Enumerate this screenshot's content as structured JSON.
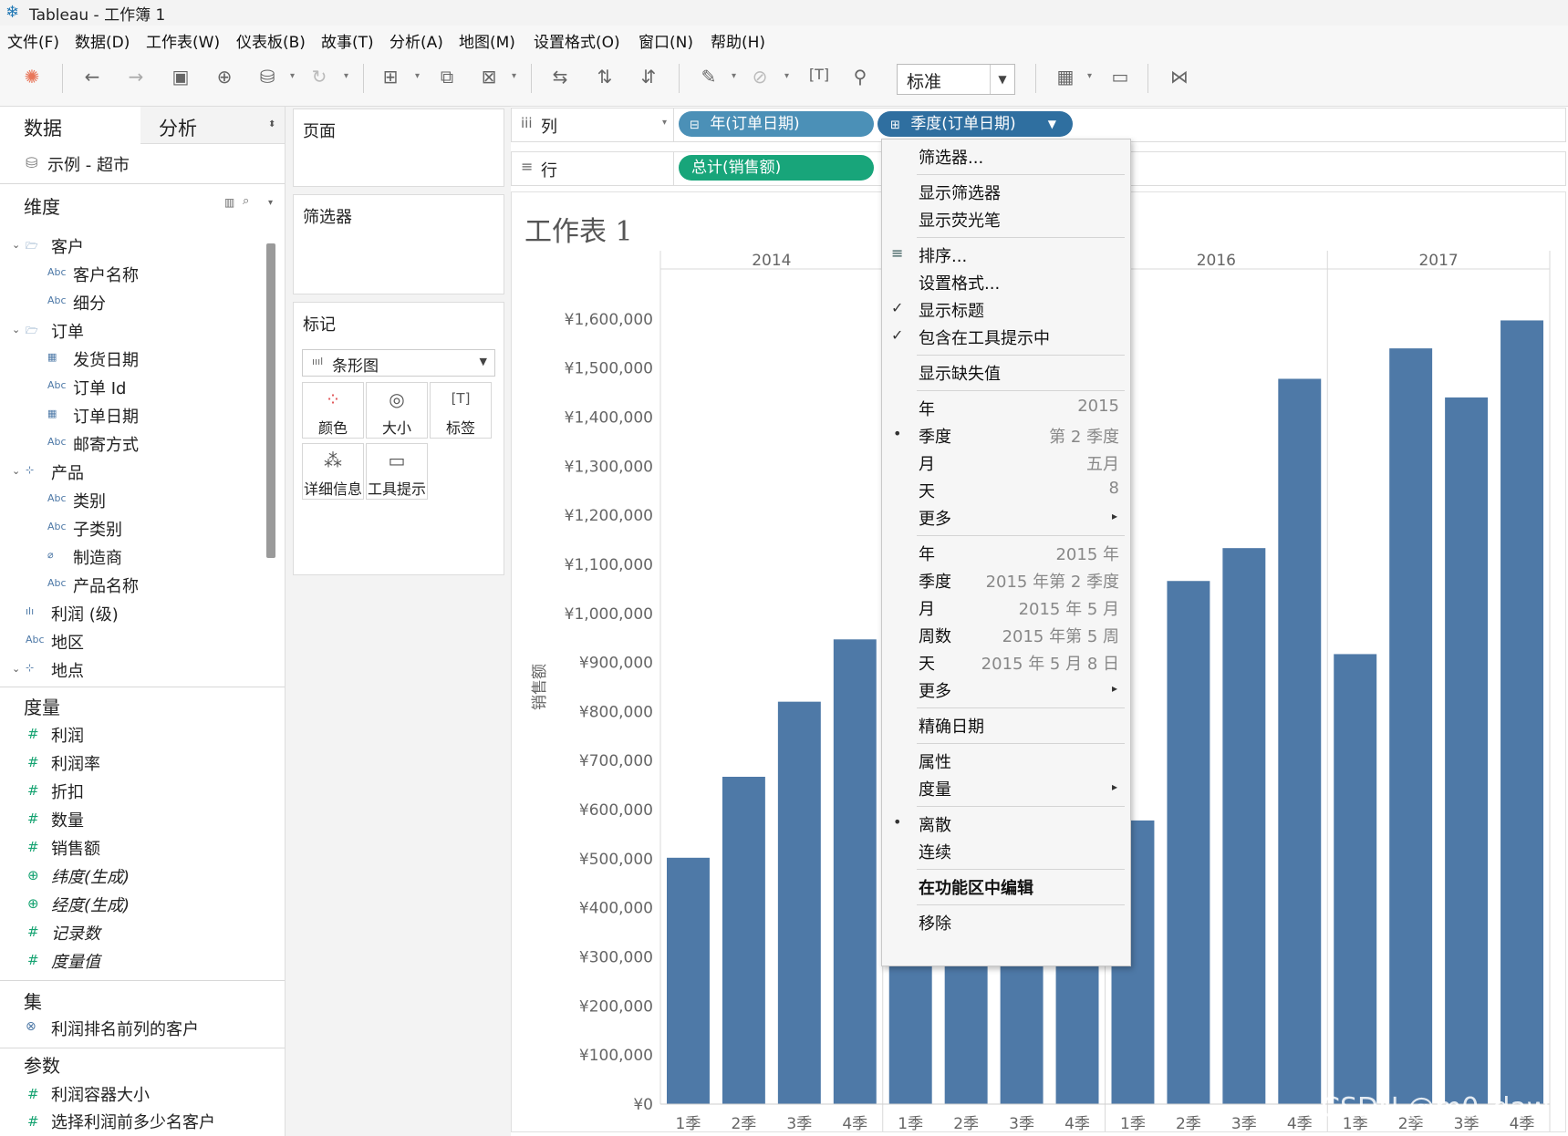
{
  "window": {
    "title": "Tableau - 工作簿 1"
  },
  "menubar": [
    "文件(F)",
    "数据(D)",
    "工作表(W)",
    "仪表板(B)",
    "故事(T)",
    "分析(A)",
    "地图(M)",
    "设置格式(O)",
    "窗口(N)",
    "帮助(H)"
  ],
  "toolbar": {
    "fit_select": "标准"
  },
  "data_pane": {
    "tab_data": "数据",
    "tab_analysis": "分析",
    "datasource": "示例 - 超市",
    "dimensions_label": "维度",
    "dimensions": [
      {
        "label": "客户",
        "icon": "folder-icon",
        "group": true
      },
      {
        "label": "客户名称",
        "icon": "Abc"
      },
      {
        "label": "细分",
        "icon": "Abc"
      },
      {
        "label": "订单",
        "icon": "folder-icon",
        "group": true
      },
      {
        "label": "发货日期",
        "icon": "calendar-icon"
      },
      {
        "label": "订单 Id",
        "icon": "Abc"
      },
      {
        "label": "订单日期",
        "icon": "calendar-icon"
      },
      {
        "label": "邮寄方式",
        "icon": "Abc"
      },
      {
        "label": "产品",
        "icon": "hierarchy-icon",
        "group": true
      },
      {
        "label": "类别",
        "icon": "Abc"
      },
      {
        "label": "子类别",
        "icon": "Abc"
      },
      {
        "label": "制造商",
        "icon": "paperclip-icon"
      },
      {
        "label": "产品名称",
        "icon": "Abc"
      },
      {
        "label": "利润 (级)",
        "icon": "bin-icon"
      },
      {
        "label": "地区",
        "icon": "Abc"
      },
      {
        "label": "地点",
        "icon": "hierarchy-icon",
        "group": true
      }
    ],
    "measures_label": "度量",
    "measures": [
      {
        "label": "利润",
        "italic": false
      },
      {
        "label": "利润率",
        "italic": false
      },
      {
        "label": "折扣",
        "italic": false
      },
      {
        "label": "数量",
        "italic": false
      },
      {
        "label": "销售额",
        "italic": false
      },
      {
        "label": "纬度(生成)",
        "italic": true
      },
      {
        "label": "经度(生成)",
        "italic": true
      },
      {
        "label": "记录数",
        "italic": true
      },
      {
        "label": "度量值",
        "italic": true
      }
    ],
    "sets_label": "集",
    "sets": [
      "利润排名前列的客户"
    ],
    "params_label": "参数",
    "params": [
      "利润容器大小",
      "选择利润前多少名客户"
    ]
  },
  "cards": {
    "pages": "页面",
    "filters": "筛选器",
    "marks": "标记",
    "mark_type": "条形图",
    "mark_buttons": [
      "颜色",
      "大小",
      "标签",
      "详细信息",
      "工具提示"
    ]
  },
  "shelves": {
    "columns_label": "列",
    "rows_label": "行",
    "col_pill_1": "年(订单日期)",
    "col_pill_2": "季度(订单日期)",
    "row_pill": "总计(销售额)"
  },
  "sheet_title": "工作表 1",
  "chart_data": {
    "type": "bar",
    "ylabel": "销售额",
    "ylim": [
      0,
      1700000
    ],
    "yticks": [
      "¥0",
      "¥100,000",
      "¥200,000",
      "¥300,000",
      "¥400,000",
      "¥500,000",
      "¥600,000",
      "¥700,000",
      "¥800,000",
      "¥900,000",
      "¥1,000,000",
      "¥1,100,000",
      "¥1,200,000",
      "¥1,300,000",
      "¥1,400,000",
      "¥1,500,000",
      "¥1,600,000"
    ],
    "panels": [
      {
        "year": "2014",
        "categories": [
          "1季",
          "2季",
          "3季",
          "4季"
        ],
        "values": [
          502000,
          667000,
          820000,
          947000
        ]
      },
      {
        "year": "2015",
        "categories": [
          "1季",
          "2季",
          "3季",
          "4季"
        ],
        "values": [
          404000,
          494000,
          497000,
          532000
        ]
      },
      {
        "year": "2016",
        "categories": [
          "1季",
          "2季",
          "3季",
          "4季"
        ],
        "values": [
          578000,
          1066000,
          1133000,
          1478000
        ]
      },
      {
        "year": "2017",
        "categories": [
          "1季",
          "2季",
          "3季",
          "4季"
        ],
        "values": [
          917000,
          1540000,
          1440000,
          1597000
        ]
      }
    ],
    "color": "#4e79a7",
    "grid": false
  },
  "context_menu": [
    {
      "label": "筛选器..."
    },
    {
      "sep": true
    },
    {
      "label": "显示筛选器"
    },
    {
      "label": "显示荧光笔"
    },
    {
      "sep": true
    },
    {
      "label": "排序...",
      "mark": "sort-icon"
    },
    {
      "label": "设置格式..."
    },
    {
      "label": "显示标题",
      "mark": "check"
    },
    {
      "label": "包含在工具提示中",
      "mark": "check"
    },
    {
      "sep": true
    },
    {
      "label": "显示缺失值"
    },
    {
      "sep": true
    },
    {
      "label": "年",
      "right": "2015"
    },
    {
      "label": "季度",
      "right": "第 2 季度",
      "mark": "dot"
    },
    {
      "label": "月",
      "right": "五月"
    },
    {
      "label": "天",
      "right": "8"
    },
    {
      "label": "更多",
      "submenu": true
    },
    {
      "sep": true
    },
    {
      "label": "年",
      "right": "2015 年"
    },
    {
      "label": "季度",
      "right": "2015 年第 2 季度"
    },
    {
      "label": "月",
      "right": "2015 年 5 月"
    },
    {
      "label": "周数",
      "right": "2015 年第 5 周"
    },
    {
      "label": "天",
      "right": "2015 年 5 月 8 日"
    },
    {
      "label": "更多",
      "submenu": true
    },
    {
      "sep": true
    },
    {
      "label": "精确日期"
    },
    {
      "sep": true
    },
    {
      "label": "属性"
    },
    {
      "label": "度量",
      "submenu": true
    },
    {
      "sep": true
    },
    {
      "label": "离散",
      "mark": "dot"
    },
    {
      "label": "连续"
    },
    {
      "sep": true
    },
    {
      "label": "在功能区中编辑",
      "bold": true
    },
    {
      "sep": true
    },
    {
      "label": "移除"
    }
  ],
  "watermark": "CSDN @m0_dawn"
}
